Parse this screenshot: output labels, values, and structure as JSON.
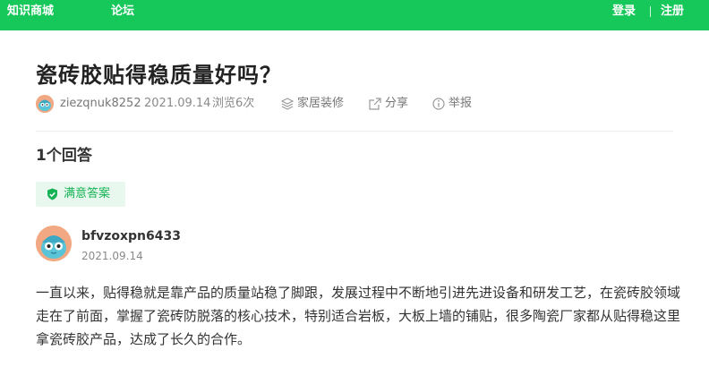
{
  "nav": {
    "left": [
      "知识商城",
      "论坛"
    ],
    "right": [
      "登录",
      "注册"
    ]
  },
  "question": {
    "title": "瓷砖胶贴得稳质量好吗？",
    "author": "ziezqnuk8252",
    "date": "2021.09.14",
    "views": "浏览6次",
    "category": "家居装修",
    "share": "分享",
    "report": "举报"
  },
  "answers_count": "1个回答",
  "answer": {
    "badge": "满意答案",
    "username": "bfvzoxpn6433",
    "date": "2021.09.14",
    "text": "一直以来，贴得稳就是靠产品的质量站稳了脚跟，发展过程中不断地引进先进设备和研发工艺，在瓷砖胶领域走在了前面，掌握了瓷砖防脱落的核心技术，特别适合岩板，大板上墙的铺贴，很多陶瓷厂家都从贴得稳这里拿瓷砖胶产品，达成了长久的合作。"
  },
  "colors": {
    "brand": "#16c75a",
    "badge_bg": "#e9f8ee",
    "badge_text": "#16b356",
    "avatar": "#f2a882"
  },
  "icons": [
    "layers-icon",
    "share-icon",
    "info-circle-icon",
    "shield-check-icon",
    "avatar-face-icon"
  ]
}
